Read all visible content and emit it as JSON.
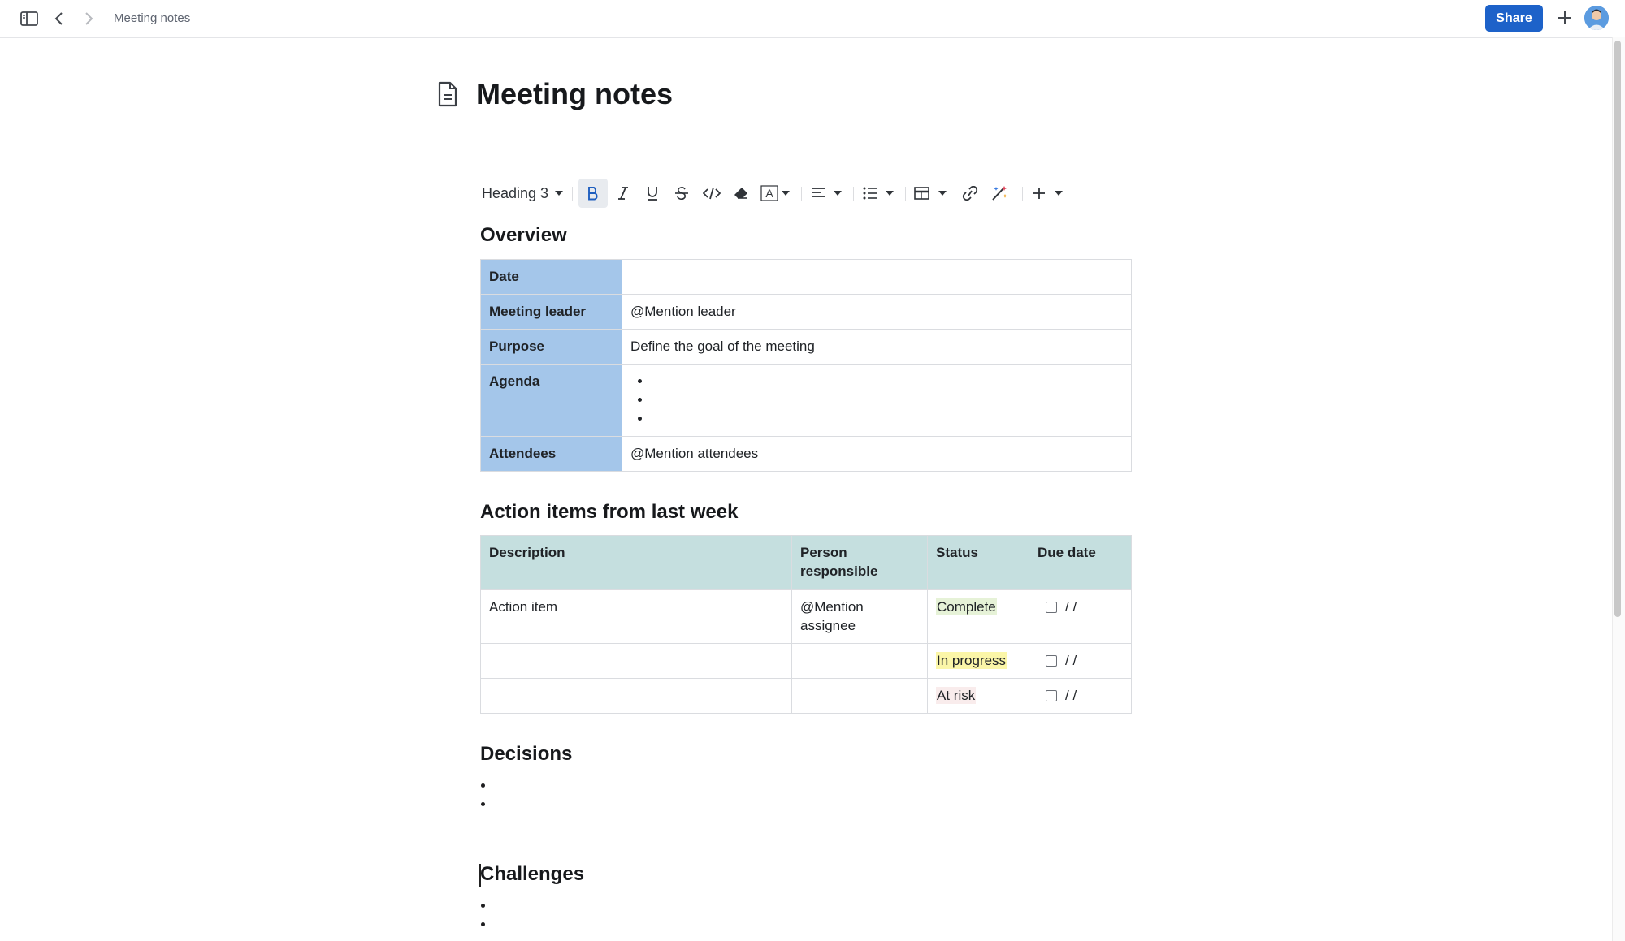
{
  "header": {
    "breadcrumb": "Meeting notes",
    "share_label": "Share",
    "icons": [
      "sidebar-toggle-icon",
      "back-arrow-icon",
      "forward-arrow-icon",
      "plus-icon",
      "avatar"
    ]
  },
  "page": {
    "title": "Meeting notes",
    "icon": "document-icon"
  },
  "toolbar": {
    "text_style": "Heading 3",
    "tools": [
      "bold-icon",
      "italic-icon",
      "underline-icon",
      "strikethrough-icon",
      "code-icon",
      "eraser-icon",
      "text-color-icon",
      "align-icon",
      "bullet-list-icon",
      "table-icon",
      "link-icon",
      "magic-wand-icon",
      "insert-plus-icon"
    ]
  },
  "overview": {
    "heading": "Overview",
    "rows": [
      {
        "label": "Date",
        "value": ""
      },
      {
        "label": "Meeting leader",
        "value": "@Mention leader"
      },
      {
        "label": "Purpose",
        "value": "Define the goal of the meeting"
      },
      {
        "label": "Agenda",
        "value": ""
      },
      {
        "label": "Attendees",
        "value": "@Mention attendees"
      }
    ]
  },
  "action_items": {
    "heading": "Action items from last week",
    "columns": [
      "Description",
      "Person responsible",
      "Status",
      "Due date"
    ],
    "rows": [
      {
        "description": "Action item",
        "person": "@Mention assignee",
        "status": "Complete",
        "due": "/ /"
      },
      {
        "description": "",
        "person": "",
        "status": "In progress",
        "due": "/ /"
      },
      {
        "description": "",
        "person": "",
        "status": "At risk",
        "due": "/ /"
      }
    ]
  },
  "decisions": {
    "heading": "Decisions"
  },
  "challenges": {
    "heading": "Challenges"
  },
  "colors": {
    "share_button": "#1d62c9",
    "overview_header": "#a4c6ea",
    "action_header": "#c5dfdf",
    "status_complete": "#e6f2d7",
    "status_in_progress": "#fbf6a8",
    "status_at_risk": "#f9ecec"
  }
}
